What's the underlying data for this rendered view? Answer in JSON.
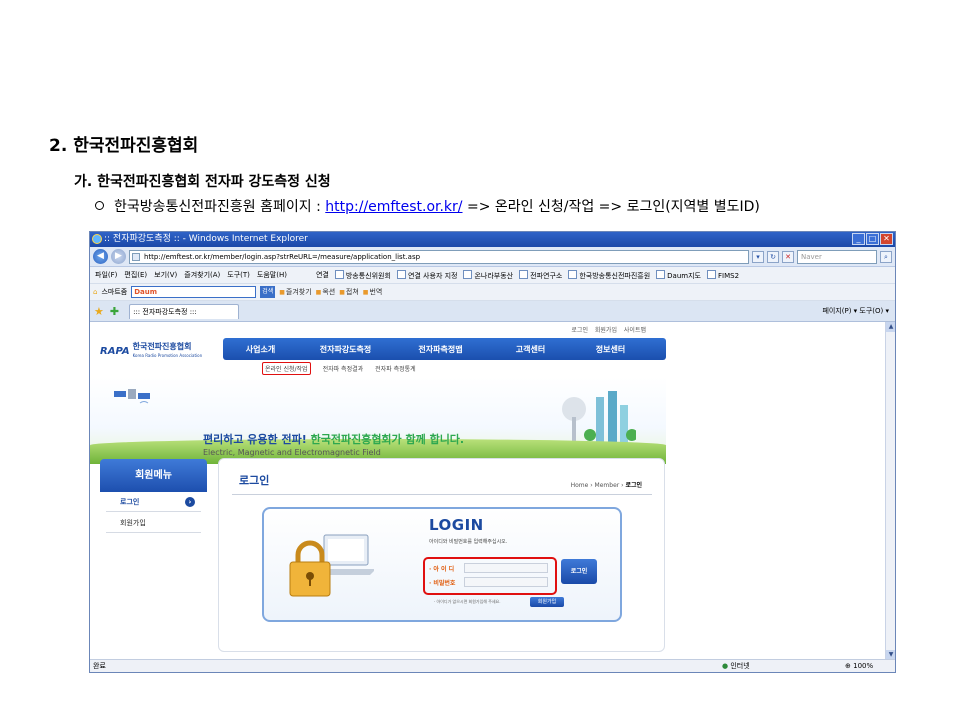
{
  "document": {
    "heading": "2. 한국전파진흥협회",
    "subheading": "가. 한국전파진흥협회 전자파 강도측정 신청",
    "bullet_prefix": "한국방송통신전파진흥원 홈페이지 : ",
    "bullet_link": "http://emftest.or.kr/",
    "bullet_suffix": " => 온라인 신청/작업  =>  로그인(지역별 별도ID)"
  },
  "browser": {
    "window_title": ":: 전자파강도측정 :: - Windows Internet Explorer",
    "address": "http://emftest.or.kr/member/login.asp?strReURL=/measure/application_list.asp",
    "search_placeholder": "Naver",
    "menu": [
      "파일(F)",
      "편집(E)",
      "보기(V)",
      "즐겨찾기(A)",
      "도구(T)",
      "도움말(H)"
    ],
    "links_label": "연결",
    "links": [
      "방송통신위원회",
      "연결 사용자 지정",
      "온나라부동산",
      "전파연구소",
      "한국방송통신전파진흥원",
      "Daum지도",
      "FIMS2"
    ],
    "toolbar2": {
      "smart": "스마트줌",
      "daum": "Daum",
      "go": "검색",
      "favorites": "즐겨찾기",
      "oksun": "옥션",
      "jeop": "접쳐",
      "translate": "번역"
    },
    "tab_title": "::: 전자파강도측정 :::",
    "tab_tools": "페이지(P) ▾  도구(O) ▾",
    "status_left": "완료",
    "status_zone": "인터넷",
    "status_zoom": "100%"
  },
  "site": {
    "util": [
      "로그인",
      "회원가입",
      "사이트맵"
    ],
    "logo_mark": "RAPA",
    "logo_name": "한국전파진흥협회",
    "logo_eng": "Korea Radio Promotion Association",
    "gnb": [
      "사업소개",
      "전자파강도측정",
      "전자파측정맵",
      "고객센터",
      "정보센터"
    ],
    "subnav": [
      "온라인 신청/작업",
      "전자파 측정결과",
      "전자파 측정통계"
    ],
    "slogan_a": "편리하고 유용한 전파! ",
    "slogan_b": "한국전파진흥협회가 함께 합니다.",
    "slogan_eng": "Electric, Magnetic and Electromagnetic Field",
    "lnb_title": "회원메뉴",
    "lnb_items": [
      "로그인",
      "회원가입"
    ],
    "page_title": "로그인",
    "breadcrumb": "Home › Member › ",
    "breadcrumb_current": "로그인",
    "login_title": "LOGIN",
    "login_desc": "아이디와 비밀번호를 입력해주십시오.",
    "id_label": "· 아 이 디",
    "pw_label": "· 비밀번호",
    "login_button": "로그인",
    "join_note": "· 아이디가 없으시면 회원가입해 주세요.",
    "join_button": "회원가입"
  }
}
